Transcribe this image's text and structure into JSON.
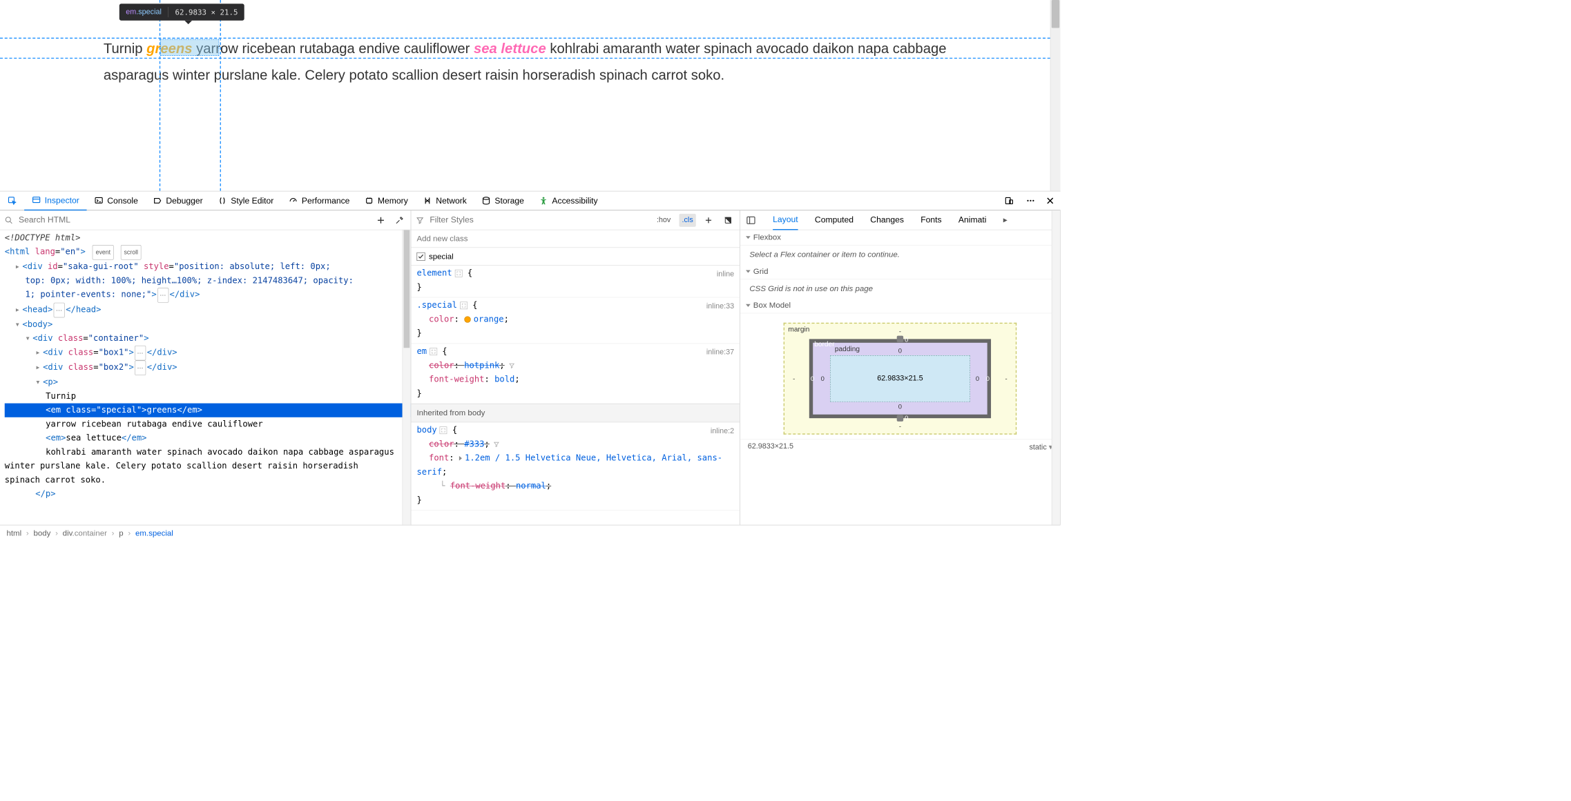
{
  "infobar": {
    "tag": "em",
    "cls": ".special",
    "dims": "62.9833 × 21.5"
  },
  "page": {
    "t1": "Turnip ",
    "em1": "greens",
    "t2": " yarrow ricebean rutabaga endive cauliflower ",
    "em2": "sea lettuce",
    "t3": " kohlrabi amaranth water spinach avocado daikon napa cabbage asparagus winter purslane kale. Celery potato scallion desert raisin horseradish spinach carrot soko."
  },
  "toolbar": {
    "inspector": "Inspector",
    "console": "Console",
    "debugger": "Debugger",
    "style": "Style Editor",
    "perf": "Performance",
    "memory": "Memory",
    "network": "Network",
    "storage": "Storage",
    "a11y": "Accessibility"
  },
  "search": {
    "placeholder": "Search HTML"
  },
  "html": {
    "doctype": "<!DOCTYPE html>",
    "html_open": "<html lang=\"en\">",
    "badge_event": "event",
    "badge_scroll": "scroll",
    "div_saka": "<div id=\"saka-gui-root\" style=\"position: absolute; left: 0px; top: 0px; width: 100%; height…100%; z-index: 2147483647; opacity: 1; pointer-events: none;\">",
    "div_close": "</div>",
    "head": "<head>",
    "head_close": "</head>",
    "body": "<body>",
    "div_container": "<div class=\"container\">",
    "div_box1": "<div class=\"box1\">",
    "div_box2": "<div class=\"box2\">",
    "p_open": "<p>",
    "p_text1": "Turnip",
    "em_special": "<em class=\"special\">greens</em>",
    "p_text2": "yarrow ricebean rutabaga endive cauliflower",
    "em_plain": "<em>sea lettuce</em>",
    "p_text3": "kohlrabi amaranth water spinach avocado daikon napa cabbage asparagus winter purslane kale. Celery potato scallion desert raisin horseradish spinach carrot soko.",
    "p_close": "</p>"
  },
  "crumbs": {
    "c1": "html",
    "c2": "body",
    "c3t": "div",
    "c3c": ".container",
    "c4": "p",
    "c5t": "em",
    "c5c": ".special"
  },
  "filter": {
    "placeholder": "Filter Styles",
    "hov": ":hov",
    "cls": ".cls",
    "addclass": "Add new class",
    "chk": "special"
  },
  "rules": {
    "r1_sel": "element",
    "r1_src": "inline",
    "r2_sel": ".special",
    "r2_src": "inline:33",
    "r2_p1": "color",
    "r2_v1": "orange",
    "r2_color": "#ffa500",
    "r3_sel": "em",
    "r3_src": "inline:37",
    "r3_p1": "color",
    "r3_v1": "hotpink",
    "r3_p2": "font-weight",
    "r3_v2": "bold",
    "inh": "Inherited from body",
    "r4_sel": "body",
    "r4_src": "inline:2",
    "r4_p1": "color",
    "r4_v1": "#333",
    "r4_p2": "font",
    "r4_v2": "1.2em / 1.5 Helvetica Neue, Helvetica, Arial, sans-serif",
    "r4_p3": "font-weight",
    "r4_v3": "normal"
  },
  "right": {
    "tabs": {
      "layout": "Layout",
      "computed": "Computed",
      "changes": "Changes",
      "fonts": "Fonts",
      "anim": "Animati"
    },
    "flex_h": "Flexbox",
    "flex_b": "Select a Flex container or item to continue.",
    "grid_h": "Grid",
    "grid_b": "CSS Grid is not in use on this page",
    "boxm_h": "Box Model",
    "bm": {
      "margin": "margin",
      "border": "border",
      "padding": "padding",
      "content": "62.9833×21.5",
      "m_t": "-",
      "m_r": "-",
      "m_b": "-",
      "m_l": "-",
      "b_t": "0",
      "b_r": "0",
      "b_b": "0",
      "b_l": "0",
      "p_t": "0",
      "p_r": "0",
      "p_b": "0",
      "p_l": "0"
    },
    "footer_dim": "62.9833×21.5",
    "footer_pos": "static"
  }
}
